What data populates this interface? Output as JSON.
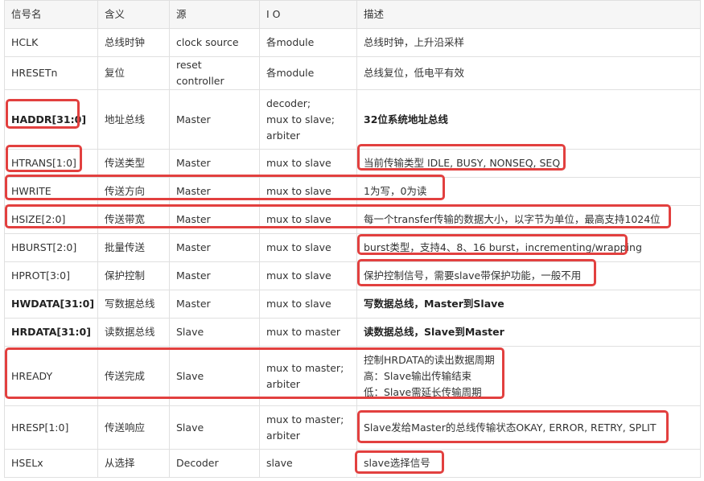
{
  "headers": [
    "信号名",
    "含义",
    "源",
    "I O",
    "描述"
  ],
  "rows": [
    {
      "name": "HCLK",
      "meaning": "总线时钟",
      "source": "clock source",
      "io": [
        "各module"
      ],
      "desc": [
        "总线时钟，上升沿采样"
      ],
      "name_bold": false,
      "desc_bold": false
    },
    {
      "name": "HRESETn",
      "meaning": "复位",
      "source": "reset controller",
      "io": [
        "各module"
      ],
      "desc": [
        "总线复位，低电平有效"
      ],
      "name_bold": false,
      "desc_bold": false
    },
    {
      "name": "HADDR[31:0]",
      "meaning": "地址总线",
      "source": "Master",
      "io": [
        "decoder;",
        "mux to slave;",
        "arbiter"
      ],
      "desc": [
        "32位系统地址总线"
      ],
      "name_bold": true,
      "desc_bold": true
    },
    {
      "name": "HTRANS[1:0]",
      "meaning": "传送类型",
      "source": "Master",
      "io": [
        "mux to slave"
      ],
      "desc": [
        "当前传输类型 IDLE, BUSY, NONSEQ, SEQ"
      ],
      "name_bold": false,
      "desc_bold": false
    },
    {
      "name": "HWRITE",
      "meaning": "传送方向",
      "source": "Master",
      "io": [
        "mux to slave"
      ],
      "desc": [
        "1为写，0为读"
      ],
      "name_bold": false,
      "desc_bold": false
    },
    {
      "name": "HSIZE[2:0]",
      "meaning": "传送带宽",
      "source": "Master",
      "io": [
        "mux to slave"
      ],
      "desc": [
        "每一个transfer传输的数据大小，以字节为单位，最高支持1024位"
      ],
      "name_bold": false,
      "desc_bold": false
    },
    {
      "name": "HBURST[2:0]",
      "meaning": "批量传送",
      "source": "Master",
      "io": [
        "mux to slave"
      ],
      "desc": [
        "burst类型，支持4、8、16 burst，incrementing/wrapping"
      ],
      "name_bold": false,
      "desc_bold": false
    },
    {
      "name": "HPROT[3:0]",
      "meaning": "保护控制",
      "source": "Master",
      "io": [
        "mux to slave"
      ],
      "desc": [
        "保护控制信号，需要slave带保护功能，一般不用"
      ],
      "name_bold": false,
      "desc_bold": false
    },
    {
      "name": "HWDATA[31:0]",
      "meaning": "写数据总线",
      "source": "Master",
      "io": [
        "mux to slave"
      ],
      "desc": [
        "写数据总线，Master到Slave"
      ],
      "name_bold": true,
      "desc_bold": true
    },
    {
      "name": "HRDATA[31:0]",
      "meaning": "读数据总线",
      "source": "Slave",
      "io": [
        "mux to master"
      ],
      "desc": [
        "读数据总线，Slave到Master"
      ],
      "name_bold": true,
      "desc_bold": true
    },
    {
      "name": "HREADY",
      "meaning": "传送完成",
      "source": "Slave",
      "io": [
        "mux to master;",
        "arbiter"
      ],
      "desc": [
        "控制HRDATA的读出数据周期",
        "高：Slave输出传输结束",
        "低：Slave需延长传输周期"
      ],
      "name_bold": false,
      "desc_bold": false
    },
    {
      "name": "HRESP[1:0]",
      "meaning": "传送响应",
      "source": "Slave",
      "io": [
        "mux to master;",
        "arbiter"
      ],
      "desc": [
        "Slave发给Master的总线传输状态OKAY, ERROR, RETRY, SPLIT"
      ],
      "name_bold": false,
      "desc_bold": false
    },
    {
      "name": "HSELx",
      "meaning": "从选择",
      "source": "Decoder",
      "io": [
        "slave"
      ],
      "desc": [
        "slave选择信号"
      ],
      "name_bold": false,
      "desc_bold": false
    }
  ],
  "highlight_color": "#e2403f"
}
